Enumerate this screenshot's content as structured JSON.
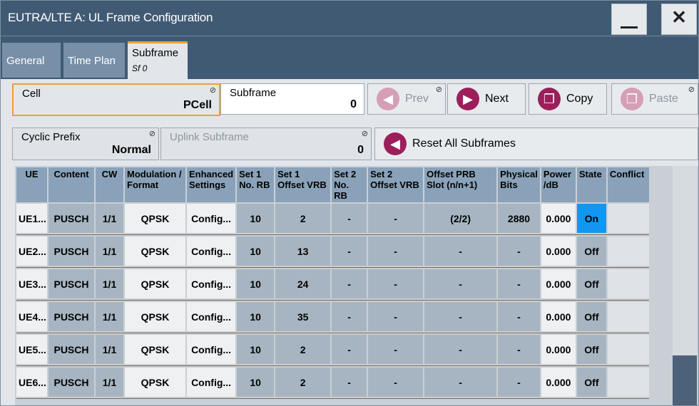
{
  "window": {
    "title": "EUTRA/LTE A: UL Frame Configuration",
    "minimize_glyph": "—",
    "close_glyph": "✕"
  },
  "tabs": [
    {
      "label": "General"
    },
    {
      "label": "Time Plan"
    },
    {
      "label": "Subframe",
      "sub": "Sf 0"
    }
  ],
  "cell": {
    "label": "Cell",
    "value": "PCell"
  },
  "subframe": {
    "label": "Subframe",
    "value": "0"
  },
  "buttons": {
    "prev": "Prev",
    "next": "Next",
    "copy": "Copy",
    "paste": "Paste",
    "reset": "Reset All Subframes"
  },
  "cyclic_prefix": {
    "label": "Cyclic Prefix",
    "value": "Normal"
  },
  "uplink_subframe": {
    "label": "Uplink Subframe",
    "value": "0"
  },
  "table": {
    "headers": [
      "UE",
      "Content",
      "CW",
      "Modulation / Format",
      "Enhanced Settings",
      "Set 1 No. RB",
      "Set 1 Offset VRB",
      "Set 2 No. RB",
      "Set 2 Offset VRB",
      "Offset PRB Slot (n/n+1)",
      "Physical Bits",
      "Power /dB",
      "State",
      "Conflict"
    ],
    "rows": [
      [
        "UE1...",
        "PUSCH",
        "1/1",
        "QPSK",
        "Config...",
        "10",
        "2",
        "-",
        "-",
        "(2/2)",
        "2880",
        "0.000",
        "On",
        ""
      ],
      [
        "UE2...",
        "PUSCH",
        "1/1",
        "QPSK",
        "Config...",
        "10",
        "13",
        "-",
        "-",
        "-",
        "-",
        "0.000",
        "Off",
        ""
      ],
      [
        "UE3...",
        "PUSCH",
        "1/1",
        "QPSK",
        "Config...",
        "10",
        "24",
        "-",
        "-",
        "-",
        "-",
        "0.000",
        "Off",
        ""
      ],
      [
        "UE4...",
        "PUSCH",
        "1/1",
        "QPSK",
        "Config...",
        "10",
        "35",
        "-",
        "-",
        "-",
        "-",
        "0.000",
        "Off",
        ""
      ],
      [
        "UE5...",
        "PUSCH",
        "1/1",
        "QPSK",
        "Config...",
        "10",
        "2",
        "-",
        "-",
        "-",
        "-",
        "0.000",
        "Off",
        ""
      ],
      [
        "UE6...",
        "PUSCH",
        "1/1",
        "QPSK",
        "Config...",
        "10",
        "2",
        "-",
        "-",
        "-",
        "-",
        "0.000",
        "Off",
        ""
      ]
    ]
  },
  "colors": {
    "titlebar": "#415a74",
    "accent": "#f0a030",
    "button_icon": "#9c1f5c",
    "state_on": "#1296f0"
  },
  "icons": {
    "prev": "arrow-left-icon",
    "next": "arrow-right-icon",
    "copy": "copy-icon",
    "paste": "paste-icon",
    "reset": "reset-icon"
  }
}
